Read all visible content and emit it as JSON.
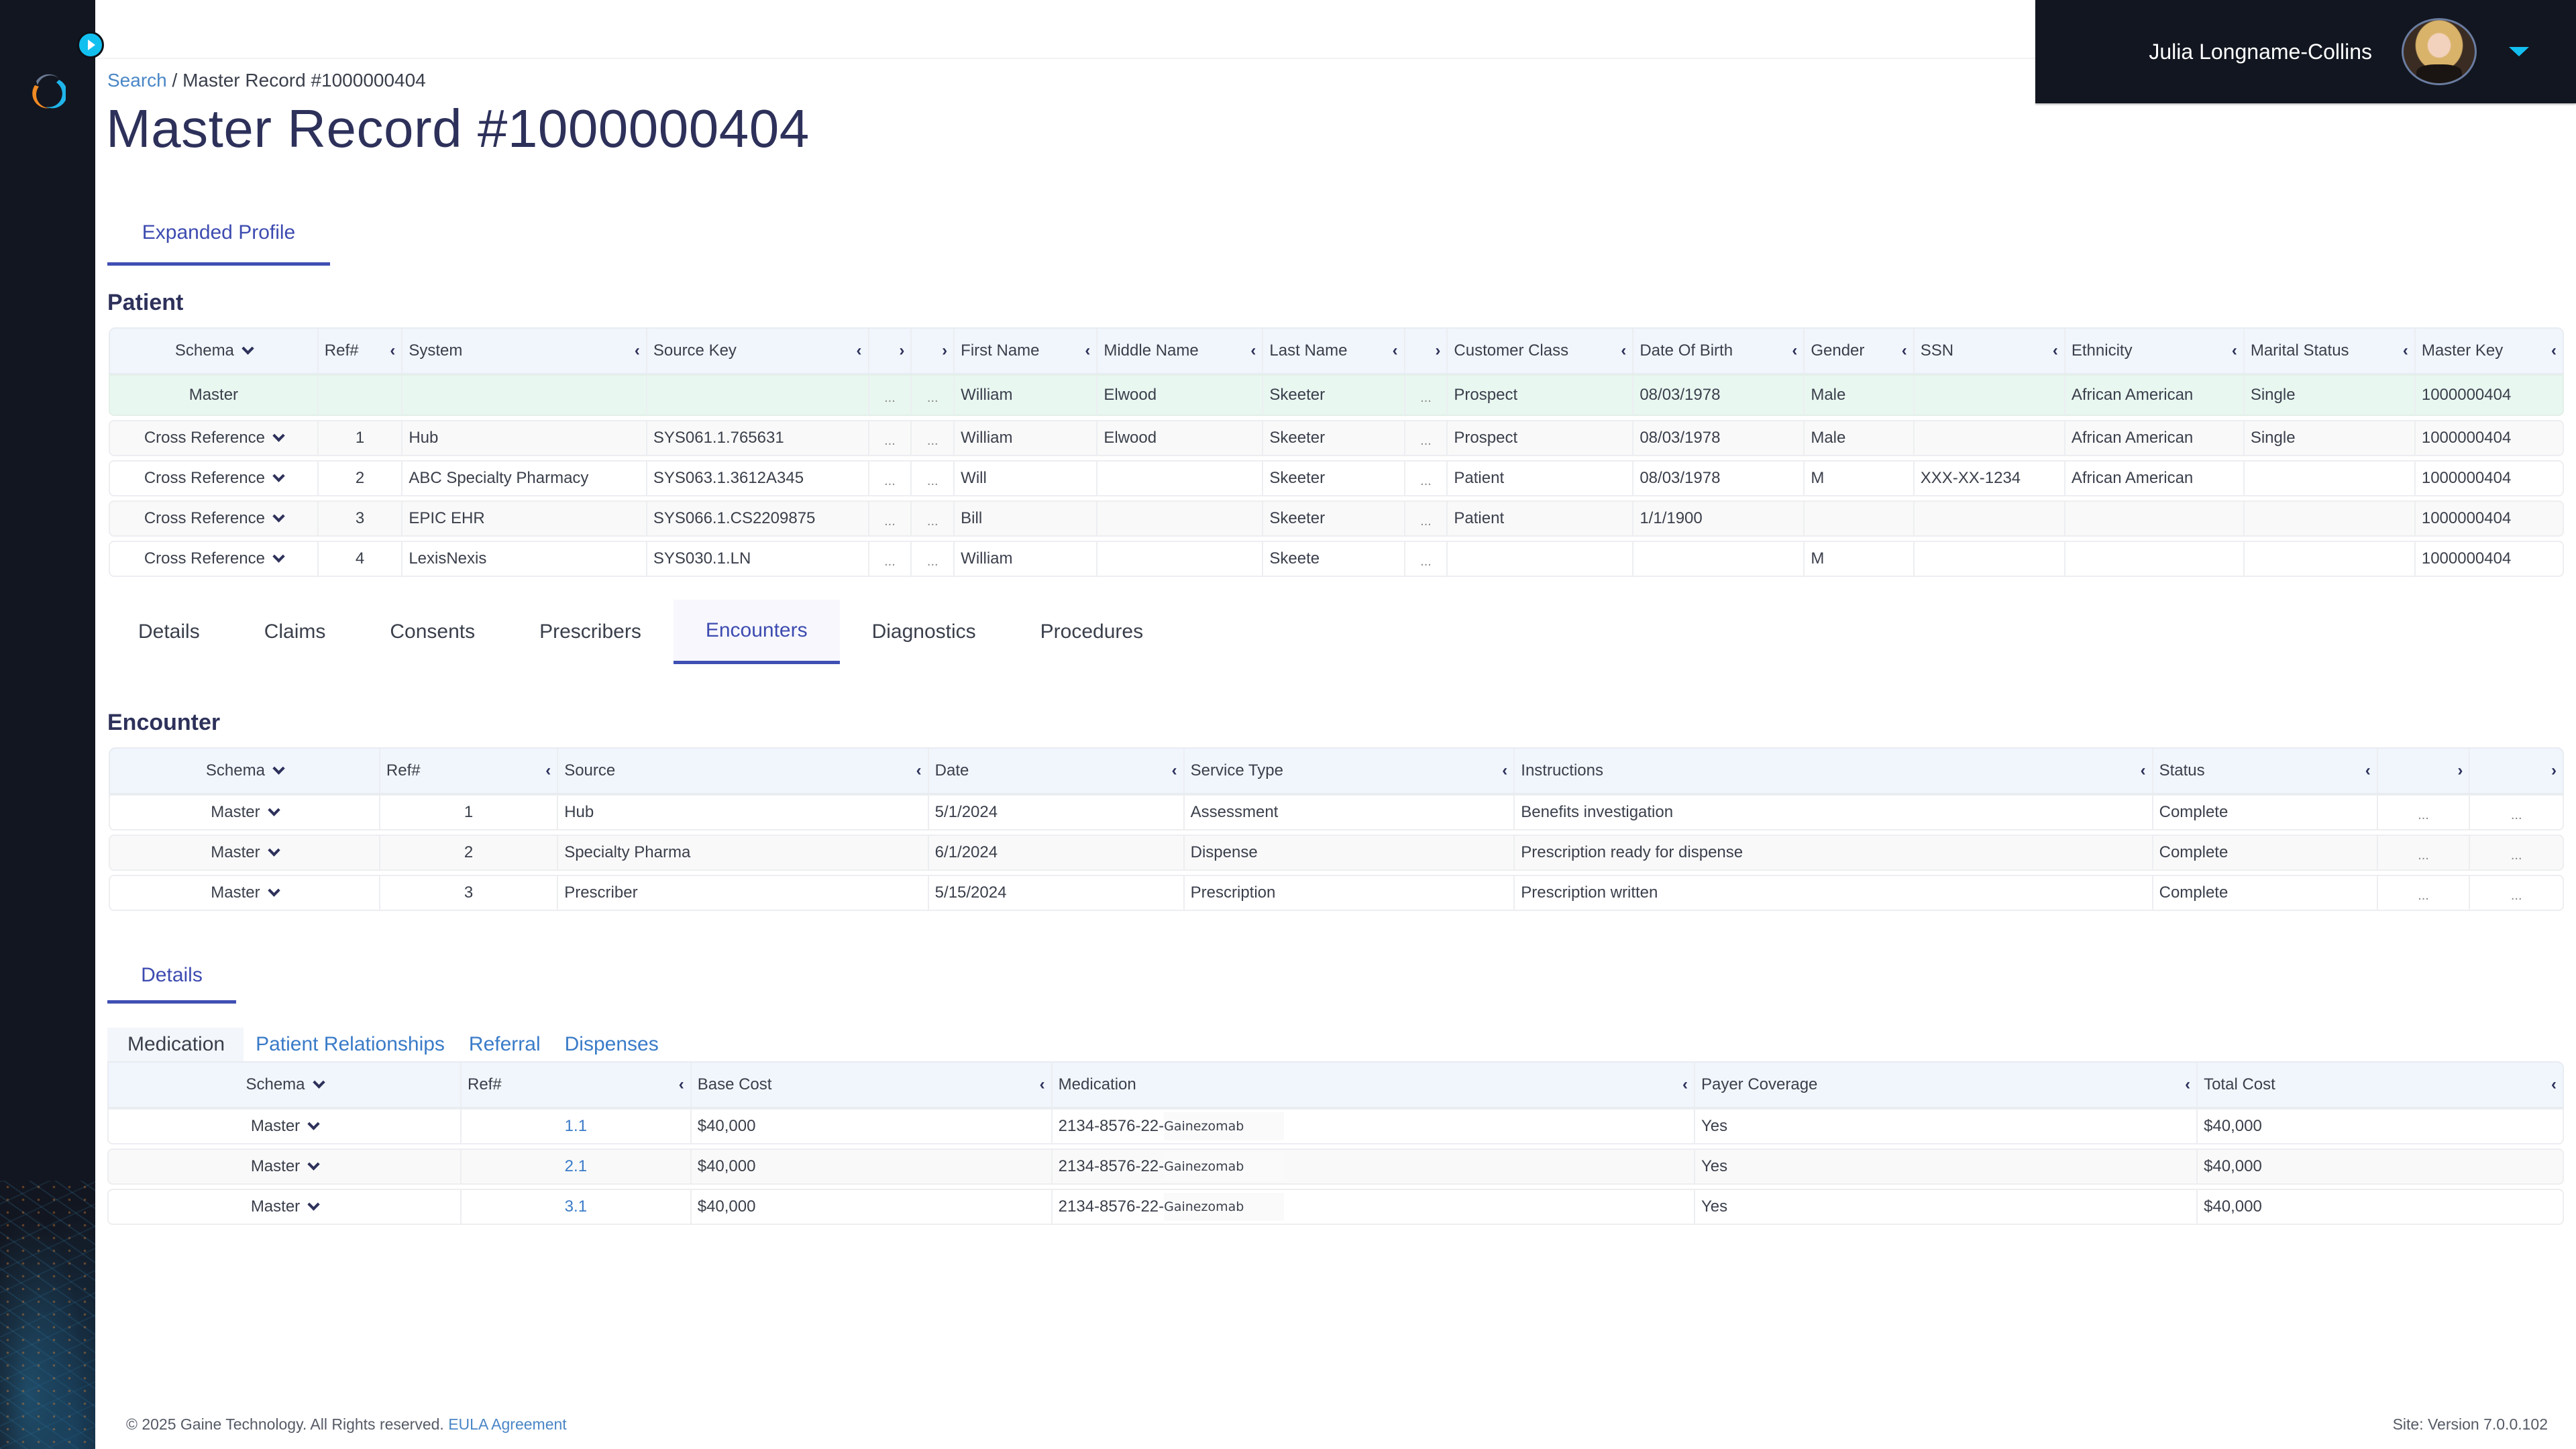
{
  "user": {
    "name": "Julia Longname-Collins"
  },
  "breadcrumb": {
    "root": "Search",
    "separator": "/",
    "current": "Master Record #1000000404"
  },
  "page_title": "Master Record #1000000404",
  "top_tab": "Expanded Profile",
  "patient": {
    "title": "Patient",
    "headers": [
      "Schema",
      "Ref#",
      "System",
      "Source Key",
      "",
      "",
      "First Name",
      "Middle Name",
      "Last Name",
      "",
      "Customer Class",
      "Date Of Birth",
      "Gender",
      "SSN",
      "Ethnicity",
      "Marital Status",
      "Master Key"
    ],
    "rows": [
      {
        "schema": "Master",
        "ref": "",
        "system": "",
        "source_key": "",
        "x1": "...",
        "x2": "...",
        "first": "William",
        "middle": "Elwood",
        "last": "Skeeter",
        "x3": "...",
        "class": "Prospect",
        "dob": "08/03/1978",
        "gender": "Male",
        "ssn": "",
        "ethnicity": "African American",
        "marital": "Single",
        "master_key": "1000000404"
      },
      {
        "schema": "Cross Reference",
        "ref": "1",
        "system": "Hub",
        "source_key": "SYS061.1.765631",
        "x1": "...",
        "x2": "...",
        "first": "William",
        "middle": "Elwood",
        "last": "Skeeter",
        "x3": "...",
        "class": "Prospect",
        "dob": "08/03/1978",
        "gender": "Male",
        "ssn": "",
        "ethnicity": "African American",
        "marital": "Single",
        "master_key": "1000000404"
      },
      {
        "schema": "Cross Reference",
        "ref": "2",
        "system": "ABC Specialty Pharmacy",
        "source_key": "SYS063.1.3612A345",
        "x1": "...",
        "x2": "...",
        "first": "Will",
        "middle": "",
        "last": "Skeeter",
        "x3": "...",
        "class": "Patient",
        "dob": "08/03/1978",
        "gender": "M",
        "ssn": "XXX-XX-1234",
        "ethnicity": "African American",
        "marital": "",
        "master_key": "1000000404"
      },
      {
        "schema": "Cross Reference",
        "ref": "3",
        "system": "EPIC EHR",
        "source_key": "SYS066.1.CS2209875",
        "x1": "...",
        "x2": "...",
        "first": "Bill",
        "middle": "",
        "last": "Skeeter",
        "x3": "...",
        "class": "Patient",
        "dob": "1/1/1900",
        "gender": "",
        "ssn": "",
        "ethnicity": "",
        "marital": "",
        "master_key": "1000000404"
      },
      {
        "schema": "Cross Reference",
        "ref": "4",
        "system": "LexisNexis",
        "source_key": "SYS030.1.LN",
        "x1": "...",
        "x2": "...",
        "first": "William",
        "middle": "",
        "last": "Skeete",
        "x3": "...",
        "class": "",
        "dob": "",
        "gender": "M",
        "ssn": "",
        "ethnicity": "",
        "marital": "",
        "master_key": "1000000404"
      }
    ]
  },
  "section_tabs": {
    "items": [
      "Details",
      "Claims",
      "Consents",
      "Prescribers",
      "Encounters",
      "Diagnostics",
      "Procedures"
    ],
    "active": "Encounters"
  },
  "encounter": {
    "title": "Encounter",
    "headers": [
      "Schema",
      "Ref#",
      "Source",
      "Date",
      "Service Type",
      "Instructions",
      "Status",
      "",
      ""
    ],
    "rows": [
      {
        "schema": "Master",
        "ref": "1",
        "source": "Hub",
        "date": "5/1/2024",
        "service_type": "Assessment",
        "instructions": "Benefits investigation",
        "status": "Complete",
        "x1": "...",
        "x2": "..."
      },
      {
        "schema": "Master",
        "ref": "2",
        "source": "Specialty Pharma",
        "date": "6/1/2024",
        "service_type": "Dispense",
        "instructions": "Prescription ready for dispense",
        "status": "Complete",
        "x1": "...",
        "x2": "..."
      },
      {
        "schema": "Master",
        "ref": "3",
        "source": "Prescriber",
        "date": "5/15/2024",
        "service_type": "Prescription",
        "instructions": "Prescription written",
        "status": "Complete",
        "x1": "...",
        "x2": "..."
      }
    ]
  },
  "details_tab": "Details",
  "sub_tabs": {
    "items": [
      "Medication",
      "Patient Relationships",
      "Referral",
      "Dispenses"
    ],
    "active": "Medication"
  },
  "medication": {
    "headers": [
      "Schema",
      "Ref#",
      "Base Cost",
      "Medication",
      "Payer Coverage",
      "Total Cost"
    ],
    "rows": [
      {
        "schema": "Master",
        "ref": "1.1",
        "base_cost": "$40,000",
        "med_code": "2134-8576-22-",
        "med_name": "Gainezomab",
        "coverage": "Yes",
        "total": "$40,000"
      },
      {
        "schema": "Master",
        "ref": "2.1",
        "base_cost": "$40,000",
        "med_code": "2134-8576-22-",
        "med_name": "Gainezomab",
        "coverage": "Yes",
        "total": "$40,000"
      },
      {
        "schema": "Master",
        "ref": "3.1",
        "base_cost": "$40,000",
        "med_code": "2134-8576-22-",
        "med_name": "Gainezomab",
        "coverage": "Yes",
        "total": "$40,000"
      }
    ]
  },
  "footer": {
    "copyright": "© 2025 Gaine Technology. All Rights reserved.",
    "eula": "EULA Agreement",
    "version": "Site: Version 7.0.0.102"
  },
  "colors": {
    "accent": "#3f4fb3",
    "link": "#3a7bc8",
    "sidebar": "#121620",
    "cyan": "#13bff0",
    "master_row": "#e9f7f1"
  }
}
